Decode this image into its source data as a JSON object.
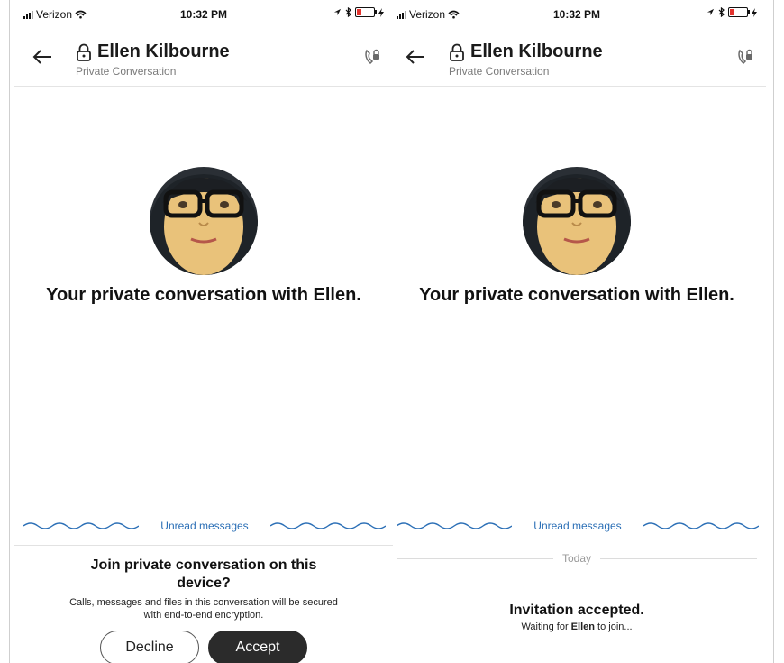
{
  "left": {
    "status": {
      "carrier": "Verizon",
      "time": "10:32 PM"
    },
    "header": {
      "title": "Ellen Kilbourne",
      "subtitle": "Private Conversation"
    },
    "intro": "Your private conversation with Ellen.",
    "unread_label": "Unread messages",
    "join": {
      "title": "Join private conversation on this device?",
      "description": "Calls, messages and files in this conversation will be secured with end-to-end encryption.",
      "decline_label": "Decline",
      "accept_label": "Accept"
    }
  },
  "right": {
    "status": {
      "carrier": "Verizon",
      "time": "10:32 PM"
    },
    "header": {
      "title": "Ellen Kilbourne",
      "subtitle": "Private Conversation"
    },
    "intro": "Your private conversation with Ellen.",
    "unread_label": "Unread messages",
    "today_label": "Today",
    "accepted": {
      "title": "Invitation accepted.",
      "waiting_prefix": "Waiting for",
      "waiting_name": "Ellen",
      "waiting_suffix": "to join..."
    }
  },
  "icons": {
    "back": "back-arrow-icon",
    "lock": "lock-icon",
    "private_call": "private-call-icon",
    "wifi": "wifi-icon",
    "location": "location-arrow-icon",
    "bluetooth": "bluetooth-icon",
    "battery": "battery-icon",
    "charging": "charging-bolt-icon"
  },
  "colors": {
    "accent": "#2b6fb6",
    "accept_button": "#2b2b2b",
    "battery_low": "#e3342f",
    "subtitle": "#7a7a7a"
  }
}
